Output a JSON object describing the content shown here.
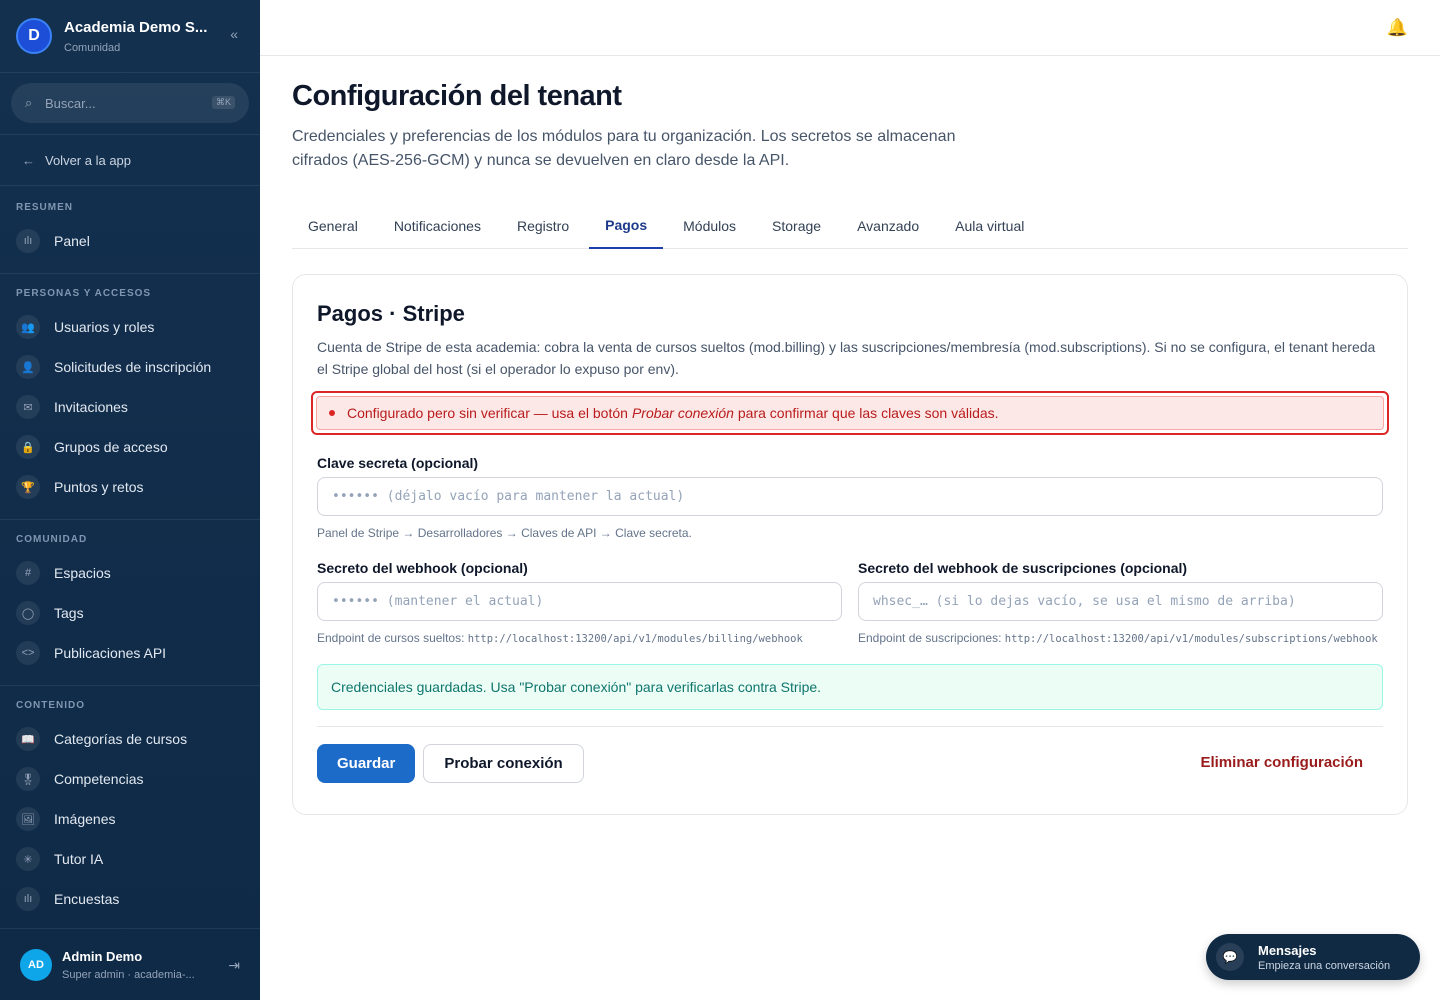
{
  "sidebar": {
    "logo_letter": "D",
    "org_name": "Academia Demo S...",
    "org_type": "Comunidad",
    "collapse_icon": "«",
    "search_placeholder": "Buscar...",
    "search_shortcut": "⌘K",
    "back_label": "Volver a la app",
    "sections": [
      {
        "label": "RESUMEN",
        "items": [
          {
            "label": "Panel",
            "icon": "ılı"
          }
        ]
      },
      {
        "label": "PERSONAS Y ACCESOS",
        "items": [
          {
            "label": "Usuarios y roles",
            "icon": "👥"
          },
          {
            "label": "Solicitudes de inscripción",
            "icon": "👤"
          },
          {
            "label": "Invitaciones",
            "icon": "✉"
          },
          {
            "label": "Grupos de acceso",
            "icon": "🔒"
          },
          {
            "label": "Puntos y retos",
            "icon": "🏆"
          }
        ]
      },
      {
        "label": "COMUNIDAD",
        "items": [
          {
            "label": "Espacios",
            "icon": "#"
          },
          {
            "label": "Tags",
            "icon": "◯"
          },
          {
            "label": "Publicaciones API",
            "icon": "<>"
          }
        ]
      },
      {
        "label": "CONTENIDO",
        "items": [
          {
            "label": "Categorías de cursos",
            "icon": "📖"
          },
          {
            "label": "Competencias",
            "icon": "🎖"
          },
          {
            "label": "Imágenes",
            "icon": "🖼"
          },
          {
            "label": "Tutor IA",
            "icon": "✳"
          },
          {
            "label": "Encuestas",
            "icon": "ılı"
          }
        ]
      }
    ],
    "user": {
      "initials": "AD",
      "name": "Admin Demo",
      "role": "Super admin · academia-...",
      "logout_icon": "⇥"
    }
  },
  "header": {
    "bell_icon": "🔔"
  },
  "page": {
    "title": "Configuración del tenant",
    "subtitle": "Credenciales y preferencias de los módulos para tu organización. Los secretos se almacenan cifrados (AES-256-GCM) y nunca se devuelven en claro desde la API.",
    "tabs": [
      "General",
      "Notificaciones",
      "Registro",
      "Pagos",
      "Módulos",
      "Storage",
      "Avanzado",
      "Aula virtual"
    ],
    "active_tab": "Pagos"
  },
  "card": {
    "title": "Pagos · Stripe",
    "description": "Cuenta de Stripe de esta academia: cobra la venta de cursos sueltos (mod.billing) y las suscripciones/membresía (mod.subscriptions). Si no se configura, el tenant hereda el Stripe global del host (si el operador lo expuso por env).",
    "warning_pre": "Configurado pero sin verificar — usa el botón",
    "warning_em": "Probar conexión",
    "warning_post": "para confirmar que las claves son válidas.",
    "secret_key": {
      "label": "Clave secreta (opcional)",
      "placeholder": "•••••• (déjalo vacío para mantener la actual)",
      "hint": "Panel de Stripe → Desarrolladores → Claves de API → Clave secreta."
    },
    "webhook": {
      "label": "Secreto del webhook (opcional)",
      "placeholder": "•••••• (mantener el actual)",
      "hint_label": "Endpoint de cursos sueltos:",
      "hint_url": "http://localhost:13200/api/v1/modules/billing/webhook"
    },
    "webhook_subs": {
      "label": "Secreto del webhook de suscripciones (opcional)",
      "placeholder": "whsec_… (si lo dejas vacío, se usa el mismo de arriba)",
      "hint_label": "Endpoint de suscripciones:",
      "hint_url": "http://localhost:13200/api/v1/modules/subscriptions/webhook"
    },
    "success_message": "Credenciales guardadas. Usa \"Probar conexión\" para verificarlas contra Stripe.",
    "save_label": "Guardar",
    "test_label": "Probar conexión",
    "delete_label": "Eliminar configuración"
  },
  "messages_widget": {
    "title": "Mensajes",
    "subtitle": "Empieza una conversación",
    "icon": "💬"
  }
}
